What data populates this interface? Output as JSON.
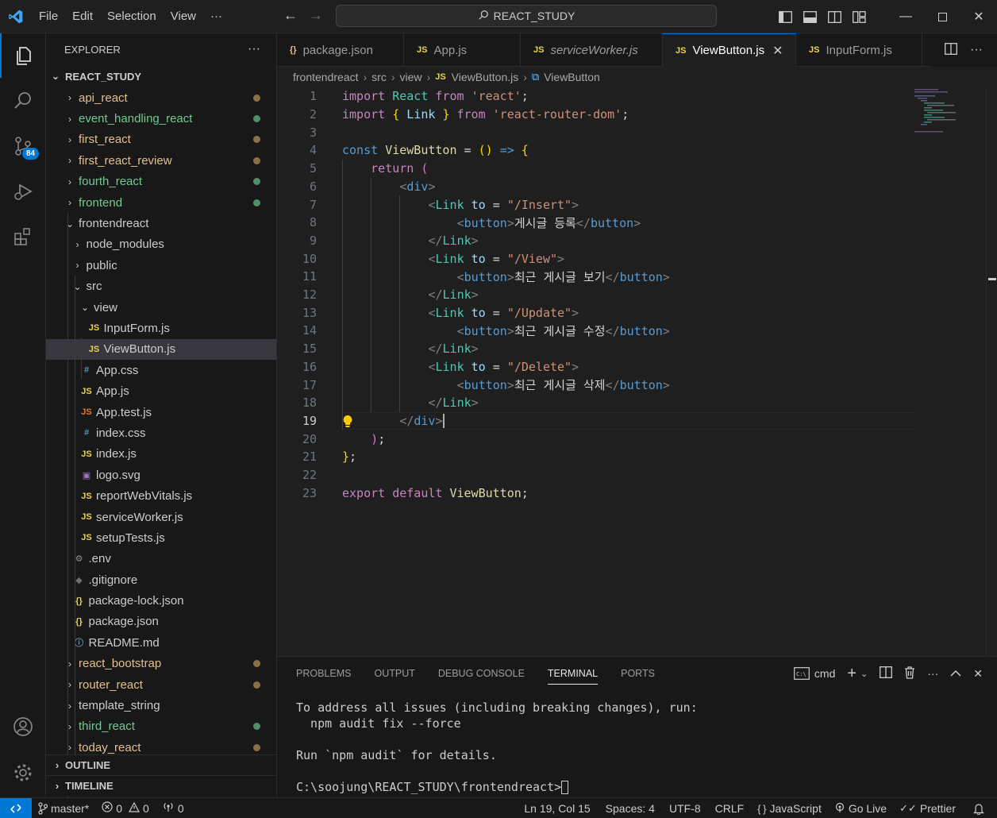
{
  "titlebar": {
    "menu": [
      "File",
      "Edit",
      "Selection",
      "View",
      "···"
    ],
    "search": "REACT_STUDY"
  },
  "activity": {
    "scm_badge": "84"
  },
  "sidebar": {
    "header": "EXPLORER",
    "more": "···",
    "root": "REACT_STUDY",
    "items": [
      {
        "label": "api_react",
        "depth": 0,
        "kind": "folder",
        "open": false,
        "color": "#e2c08d",
        "dot": "#8b6f47"
      },
      {
        "label": "event_handling_react",
        "depth": 0,
        "kind": "folder",
        "open": false,
        "color": "#73c991",
        "dot": "#4f8f63"
      },
      {
        "label": "first_react",
        "depth": 0,
        "kind": "folder",
        "open": false,
        "color": "#e2c08d",
        "dot": "#8b6f47"
      },
      {
        "label": "first_react_review",
        "depth": 0,
        "kind": "folder",
        "open": false,
        "color": "#e2c08d",
        "dot": "#8b6f47"
      },
      {
        "label": "fourth_react",
        "depth": 0,
        "kind": "folder",
        "open": false,
        "color": "#73c991",
        "dot": "#4f8f63"
      },
      {
        "label": "frontend",
        "depth": 0,
        "kind": "folder",
        "open": false,
        "color": "#73c991",
        "dot": "#4f8f63"
      },
      {
        "label": "frontendreact",
        "depth": 0,
        "kind": "folder",
        "open": true,
        "color": "#cccccc",
        "dot": ""
      },
      {
        "label": "node_modules",
        "depth": 1,
        "kind": "folder",
        "open": false,
        "color": "#cccccc",
        "dot": ""
      },
      {
        "label": "public",
        "depth": 1,
        "kind": "folder",
        "open": false,
        "color": "#cccccc",
        "dot": ""
      },
      {
        "label": "src",
        "depth": 1,
        "kind": "folder",
        "open": true,
        "color": "#cccccc",
        "dot": ""
      },
      {
        "label": "view",
        "depth": 2,
        "kind": "folder",
        "open": true,
        "color": "#cccccc",
        "dot": ""
      },
      {
        "label": "InputForm.js",
        "depth": 3,
        "kind": "js",
        "color": "#cccccc",
        "dot": ""
      },
      {
        "label": "ViewButton.js",
        "depth": 3,
        "kind": "js",
        "color": "#cccccc",
        "dot": "",
        "selected": true
      },
      {
        "label": "App.css",
        "depth": 2,
        "kind": "css",
        "color": "#cccccc",
        "dot": ""
      },
      {
        "label": "App.js",
        "depth": 2,
        "kind": "js",
        "color": "#cccccc",
        "dot": ""
      },
      {
        "label": "App.test.js",
        "depth": 2,
        "kind": "test",
        "color": "#cccccc",
        "dot": ""
      },
      {
        "label": "index.css",
        "depth": 2,
        "kind": "css",
        "color": "#cccccc",
        "dot": ""
      },
      {
        "label": "index.js",
        "depth": 2,
        "kind": "js",
        "color": "#cccccc",
        "dot": ""
      },
      {
        "label": "logo.svg",
        "depth": 2,
        "kind": "svg",
        "color": "#cccccc",
        "dot": ""
      },
      {
        "label": "reportWebVitals.js",
        "depth": 2,
        "kind": "js",
        "color": "#cccccc",
        "dot": ""
      },
      {
        "label": "serviceWorker.js",
        "depth": 2,
        "kind": "js",
        "color": "#cccccc",
        "dot": ""
      },
      {
        "label": "setupTests.js",
        "depth": 2,
        "kind": "js",
        "color": "#cccccc",
        "dot": ""
      },
      {
        "label": ".env",
        "depth": 1,
        "kind": "gear",
        "color": "#cccccc",
        "dot": ""
      },
      {
        "label": ".gitignore",
        "depth": 1,
        "kind": "git",
        "color": "#cccccc",
        "dot": ""
      },
      {
        "label": "package-lock.json",
        "depth": 1,
        "kind": "json",
        "color": "#cccccc",
        "dot": ""
      },
      {
        "label": "package.json",
        "depth": 1,
        "kind": "json",
        "color": "#cccccc",
        "dot": ""
      },
      {
        "label": "README.md",
        "depth": 1,
        "kind": "info",
        "color": "#cccccc",
        "dot": ""
      },
      {
        "label": "react_bootstrap",
        "depth": 0,
        "kind": "folder",
        "open": false,
        "color": "#e2c08d",
        "dot": "#8b6f47"
      },
      {
        "label": "router_react",
        "depth": 0,
        "kind": "folder",
        "open": false,
        "color": "#e2c08d",
        "dot": "#8b6f47"
      },
      {
        "label": "template_string",
        "depth": 0,
        "kind": "folder",
        "open": false,
        "color": "#cccccc",
        "dot": ""
      },
      {
        "label": "third_react",
        "depth": 0,
        "kind": "folder",
        "open": false,
        "color": "#73c991",
        "dot": "#4f8f63"
      },
      {
        "label": "today_react",
        "depth": 0,
        "kind": "folder",
        "open": false,
        "color": "#e2c08d",
        "dot": "#8b6f47"
      }
    ],
    "outline": "OUTLINE",
    "timeline": "TIMELINE"
  },
  "tabs": [
    {
      "label": "package.json",
      "icon": "{}",
      "icon_color": "#e2c08d",
      "italic": false,
      "active": false
    },
    {
      "label": "App.js",
      "icon": "JS",
      "icon_color": "#e8d44d",
      "italic": false,
      "active": false
    },
    {
      "label": "serviceWorker.js",
      "icon": "JS",
      "icon_color": "#e8d44d",
      "italic": true,
      "active": false
    },
    {
      "label": "ViewButton.js",
      "icon": "JS",
      "icon_color": "#e8d44d",
      "italic": false,
      "active": true
    },
    {
      "label": "InputForm.js",
      "icon": "JS",
      "icon_color": "#e8d44d",
      "italic": false,
      "active": false
    }
  ],
  "breadcrumb": {
    "parts": [
      "frontendreact",
      "src",
      "view",
      "ViewButton.js",
      "ViewButton"
    ]
  },
  "editor": {
    "current_line": 19,
    "lines": [
      {
        "n": "1",
        "indent": 0,
        "tokens": [
          [
            "kw2",
            "import "
          ],
          [
            "cls",
            "React "
          ],
          [
            "kw2",
            "from "
          ],
          [
            "str",
            "'react'"
          ],
          [
            "punc",
            ";"
          ]
        ]
      },
      {
        "n": "2",
        "indent": 0,
        "tokens": [
          [
            "kw2",
            "import "
          ],
          [
            "brk",
            "{ "
          ],
          [
            "var",
            "Link "
          ],
          [
            "brk",
            "} "
          ],
          [
            "kw2",
            "from "
          ],
          [
            "str",
            "'react-router-dom'"
          ],
          [
            "punc",
            ";"
          ]
        ]
      },
      {
        "n": "3",
        "indent": 0,
        "tokens": []
      },
      {
        "n": "4",
        "indent": 0,
        "tokens": [
          [
            "kw",
            "const "
          ],
          [
            "fn",
            "ViewButton "
          ],
          [
            "punc",
            "= "
          ],
          [
            "brk",
            "() "
          ],
          [
            "kw",
            "=> "
          ],
          [
            "brk",
            "{"
          ]
        ]
      },
      {
        "n": "5",
        "indent": 1,
        "tokens": [
          [
            "kw2",
            "return "
          ],
          [
            "brk2",
            "("
          ]
        ]
      },
      {
        "n": "6",
        "indent": 2,
        "tokens": [
          [
            "tagb",
            "<"
          ],
          [
            "tag",
            "div"
          ],
          [
            "tagb",
            ">"
          ]
        ]
      },
      {
        "n": "7",
        "indent": 3,
        "tokens": [
          [
            "tagb",
            "<"
          ],
          [
            "cls",
            "Link "
          ],
          [
            "var",
            "to "
          ],
          [
            "punc",
            "= "
          ],
          [
            "str",
            "\"/Insert\""
          ],
          [
            "tagb",
            ">"
          ]
        ]
      },
      {
        "n": "8",
        "indent": 4,
        "tokens": [
          [
            "tagb",
            "<"
          ],
          [
            "tag",
            "button"
          ],
          [
            "tagb",
            ">"
          ],
          [
            "txt",
            "게시글 등록"
          ],
          [
            "tagb",
            "</"
          ],
          [
            "tag",
            "button"
          ],
          [
            "tagb",
            ">"
          ]
        ]
      },
      {
        "n": "9",
        "indent": 3,
        "tokens": [
          [
            "tagb",
            "</"
          ],
          [
            "cls",
            "Link"
          ],
          [
            "tagb",
            ">"
          ]
        ]
      },
      {
        "n": "10",
        "indent": 3,
        "tokens": [
          [
            "tagb",
            "<"
          ],
          [
            "cls",
            "Link "
          ],
          [
            "var",
            "to "
          ],
          [
            "punc",
            "= "
          ],
          [
            "str",
            "\"/View\""
          ],
          [
            "tagb",
            ">"
          ]
        ]
      },
      {
        "n": "11",
        "indent": 4,
        "tokens": [
          [
            "tagb",
            "<"
          ],
          [
            "tag",
            "button"
          ],
          [
            "tagb",
            ">"
          ],
          [
            "txt",
            "최근 게시글 보기"
          ],
          [
            "tagb",
            "</"
          ],
          [
            "tag",
            "button"
          ],
          [
            "tagb",
            ">"
          ]
        ]
      },
      {
        "n": "12",
        "indent": 3,
        "tokens": [
          [
            "tagb",
            "</"
          ],
          [
            "cls",
            "Link"
          ],
          [
            "tagb",
            ">"
          ]
        ]
      },
      {
        "n": "13",
        "indent": 3,
        "tokens": [
          [
            "tagb",
            "<"
          ],
          [
            "cls",
            "Link "
          ],
          [
            "var",
            "to "
          ],
          [
            "punc",
            "= "
          ],
          [
            "str",
            "\"/Update\""
          ],
          [
            "tagb",
            ">"
          ]
        ]
      },
      {
        "n": "14",
        "indent": 4,
        "tokens": [
          [
            "tagb",
            "<"
          ],
          [
            "tag",
            "button"
          ],
          [
            "tagb",
            ">"
          ],
          [
            "txt",
            "최근 게시글 수정"
          ],
          [
            "tagb",
            "</"
          ],
          [
            "tag",
            "button"
          ],
          [
            "tagb",
            ">"
          ]
        ]
      },
      {
        "n": "15",
        "indent": 3,
        "tokens": [
          [
            "tagb",
            "</"
          ],
          [
            "cls",
            "Link"
          ],
          [
            "tagb",
            ">"
          ]
        ]
      },
      {
        "n": "16",
        "indent": 3,
        "tokens": [
          [
            "tagb",
            "<"
          ],
          [
            "cls",
            "Link "
          ],
          [
            "var",
            "to "
          ],
          [
            "punc",
            "= "
          ],
          [
            "str",
            "\"/Delete\""
          ],
          [
            "tagb",
            ">"
          ]
        ]
      },
      {
        "n": "17",
        "indent": 4,
        "tokens": [
          [
            "tagb",
            "<"
          ],
          [
            "tag",
            "button"
          ],
          [
            "tagb",
            ">"
          ],
          [
            "txt",
            "최근 게시글 삭제"
          ],
          [
            "tagb",
            "</"
          ],
          [
            "tag",
            "button"
          ],
          [
            "tagb",
            ">"
          ]
        ]
      },
      {
        "n": "18",
        "indent": 3,
        "tokens": [
          [
            "tagb",
            "</"
          ],
          [
            "cls",
            "Link"
          ],
          [
            "tagb",
            ">"
          ]
        ]
      },
      {
        "n": "19",
        "indent": 2,
        "tokens": [
          [
            "tagb",
            "</"
          ],
          [
            "tag",
            "div"
          ],
          [
            "tagb",
            ">"
          ]
        ]
      },
      {
        "n": "20",
        "indent": 1,
        "tokens": [
          [
            "brk2",
            ")"
          ],
          [
            "punc",
            ";"
          ]
        ]
      },
      {
        "n": "21",
        "indent": 0,
        "tokens": [
          [
            "brk",
            "}"
          ],
          [
            "punc",
            ";"
          ]
        ]
      },
      {
        "n": "22",
        "indent": 0,
        "tokens": []
      },
      {
        "n": "23",
        "indent": 0,
        "tokens": [
          [
            "kw2",
            "export "
          ],
          [
            "kw2",
            "default "
          ],
          [
            "fn",
            "ViewButton"
          ],
          [
            "punc",
            ";"
          ]
        ]
      }
    ]
  },
  "panel": {
    "tabs": [
      "PROBLEMS",
      "OUTPUT",
      "DEBUG CONSOLE",
      "TERMINAL",
      "PORTS"
    ],
    "active_tab": "TERMINAL",
    "shell": "cmd",
    "terminal_lines": [
      "To address all issues (including breaking changes), run:",
      "  npm audit fix --force",
      "",
      "Run `npm audit` for details.",
      "",
      "C:\\soojung\\REACT_STUDY\\frontendreact>"
    ]
  },
  "statusbar": {
    "branch": "master*",
    "errors": "0",
    "warnings": "0",
    "ports": "0",
    "position": "Ln 19, Col 15",
    "spaces": "Spaces: 4",
    "encoding": "UTF-8",
    "eol": "CRLF",
    "language": "JavaScript",
    "golive": "Go Live",
    "prettier": "Prettier"
  }
}
